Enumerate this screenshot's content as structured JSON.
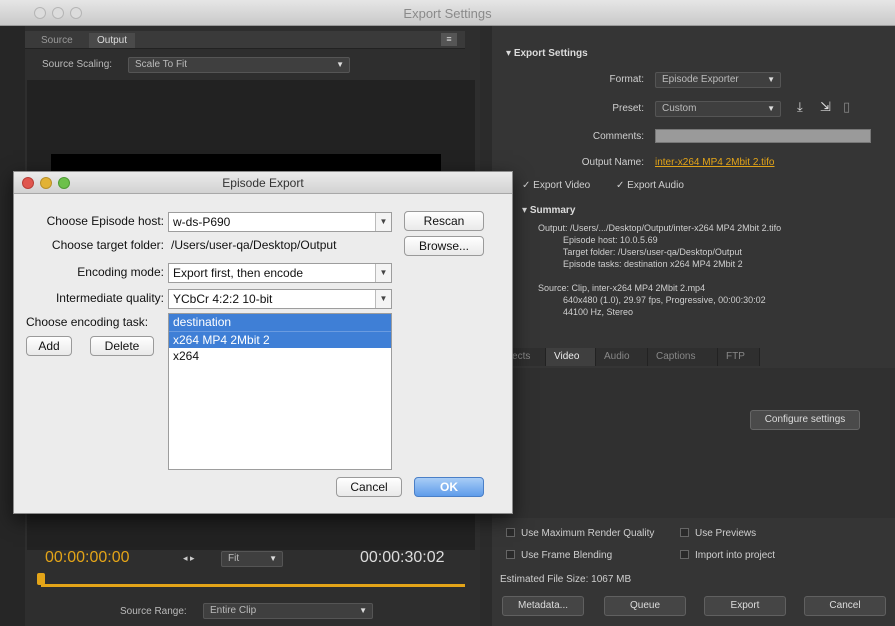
{
  "window": {
    "title": "Export Settings"
  },
  "left_pane": {
    "tabs": [
      "Source",
      "Output"
    ],
    "source_scaling_label": "Source Scaling:",
    "source_scaling_value": "Scale To Fit",
    "timecode_start": "00:00:00:00",
    "timecode_end": "00:00:30:02",
    "fit_value": "Fit",
    "source_range_label": "Source Range:",
    "source_range_value": "Entire Clip"
  },
  "export_settings": {
    "header": "Export Settings",
    "format_label": "Format:",
    "format_value": "Episode Exporter",
    "preset_label": "Preset:",
    "preset_value": "Custom",
    "comments_label": "Comments:",
    "output_name_label": "Output Name:",
    "output_name_value": "inter-x264 MP4 2Mbit 2.tifo",
    "export_video_label": "Export Video",
    "export_audio_label": "Export Audio",
    "summary_header": "Summary",
    "summary_output": "Output: /Users/.../Desktop/Output/inter-x264 MP4 2Mbit 2.tifo\n          Episode host: 10.0.5.69\n          Target folder: /Users/user-qa/Desktop/Output\n          Episode tasks: destination x264 MP4 2Mbit 2",
    "summary_source": "Source: Clip, inter-x264 MP4 2Mbit 2.mp4\n          640x480 (1.0), 29.97 fps, Progressive, 00:00:30:02\n          44100 Hz, Stereo",
    "tabs": [
      "Effects",
      "Video",
      "Audio",
      "Captions",
      "FTP"
    ],
    "configure_button": "Configure settings",
    "use_max_render_quality": "Use Maximum Render Quality",
    "use_previews": "Use Previews",
    "use_frame_blending": "Use Frame Blending",
    "import_into_project": "Import into project",
    "estimated_file_size": "Estimated File Size: 1067 MB",
    "buttons": {
      "metadata": "Metadata...",
      "queue": "Queue",
      "export": "Export",
      "cancel": "Cancel"
    }
  },
  "dialog": {
    "title": "Episode Export",
    "host_label": "Choose Episode host:",
    "host_value": "w-ds-P690",
    "rescan_button": "Rescan",
    "folder_label": "Choose target folder:",
    "folder_value": "/Users/user-qa/Desktop/Output",
    "browse_button": "Browse...",
    "encoding_mode_label": "Encoding mode:",
    "encoding_mode_value": "Export first, then encode",
    "quality_label": "Intermediate quality:",
    "quality_value": "YCbCr 4:2:2 10-bit",
    "task_label": "Choose encoding task:",
    "add_button": "Add",
    "delete_button": "Delete",
    "tasks": [
      "destination",
      "x264 MP4 2Mbit 2",
      "x264"
    ],
    "cancel_button": "Cancel",
    "ok_button": "OK"
  },
  "colors": {
    "accent_orange": "#e3a418",
    "selection_blue": "#3f7fd6"
  }
}
